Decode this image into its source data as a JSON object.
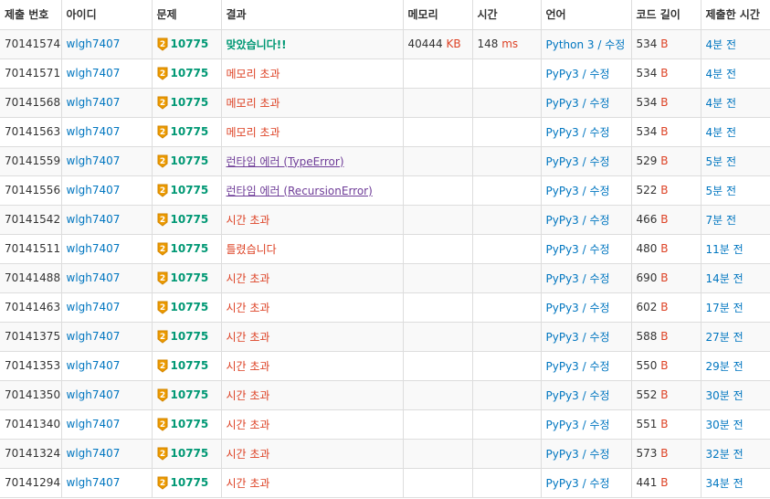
{
  "headers": [
    "제출 번호",
    "아이디",
    "문제",
    "결과",
    "메모리",
    "시간",
    "언어",
    "코드 길이",
    "제출한 시간"
  ],
  "edit_label": "수정",
  "tier_badge": "2",
  "mem_unit": "KB",
  "time_unit": "ms",
  "len_unit": "B",
  "rows": [
    {
      "id": "70141574",
      "user": "wlgh7407",
      "problem": "10775",
      "result": "맞았습니다!!",
      "rclass": "green-bold",
      "memory": "40444",
      "time": "148",
      "lang": "Python 3",
      "len": "534",
      "ago": "4분 전"
    },
    {
      "id": "70141571",
      "user": "wlgh7407",
      "problem": "10775",
      "result": "메모리 초과",
      "rclass": "red",
      "memory": "",
      "time": "",
      "lang": "PyPy3",
      "len": "534",
      "ago": "4분 전"
    },
    {
      "id": "70141568",
      "user": "wlgh7407",
      "problem": "10775",
      "result": "메모리 초과",
      "rclass": "red",
      "memory": "",
      "time": "",
      "lang": "PyPy3",
      "len": "534",
      "ago": "4분 전"
    },
    {
      "id": "70141563",
      "user": "wlgh7407",
      "problem": "10775",
      "result": "메모리 초과",
      "rclass": "red",
      "memory": "",
      "time": "",
      "lang": "PyPy3",
      "len": "534",
      "ago": "4분 전"
    },
    {
      "id": "70141559",
      "user": "wlgh7407",
      "problem": "10775",
      "result": "런타임 에러 (TypeError)",
      "rclass": "rt",
      "memory": "",
      "time": "",
      "lang": "PyPy3",
      "len": "529",
      "ago": "5분 전"
    },
    {
      "id": "70141556",
      "user": "wlgh7407",
      "problem": "10775",
      "result": "런타임 에러 (RecursionError)",
      "rclass": "rt",
      "memory": "",
      "time": "",
      "lang": "PyPy3",
      "len": "522",
      "ago": "5분 전"
    },
    {
      "id": "70141542",
      "user": "wlgh7407",
      "problem": "10775",
      "result": "시간 초과",
      "rclass": "red",
      "memory": "",
      "time": "",
      "lang": "PyPy3",
      "len": "466",
      "ago": "7분 전"
    },
    {
      "id": "70141511",
      "user": "wlgh7407",
      "problem": "10775",
      "result": "틀렸습니다",
      "rclass": "red",
      "memory": "",
      "time": "",
      "lang": "PyPy3",
      "len": "480",
      "ago": "11분 전"
    },
    {
      "id": "70141488",
      "user": "wlgh7407",
      "problem": "10775",
      "result": "시간 초과",
      "rclass": "red",
      "memory": "",
      "time": "",
      "lang": "PyPy3",
      "len": "690",
      "ago": "14분 전"
    },
    {
      "id": "70141463",
      "user": "wlgh7407",
      "problem": "10775",
      "result": "시간 초과",
      "rclass": "red",
      "memory": "",
      "time": "",
      "lang": "PyPy3",
      "len": "602",
      "ago": "17분 전"
    },
    {
      "id": "70141375",
      "user": "wlgh7407",
      "problem": "10775",
      "result": "시간 초과",
      "rclass": "red",
      "memory": "",
      "time": "",
      "lang": "PyPy3",
      "len": "588",
      "ago": "27분 전"
    },
    {
      "id": "70141353",
      "user": "wlgh7407",
      "problem": "10775",
      "result": "시간 초과",
      "rclass": "red",
      "memory": "",
      "time": "",
      "lang": "PyPy3",
      "len": "550",
      "ago": "29분 전"
    },
    {
      "id": "70141350",
      "user": "wlgh7407",
      "problem": "10775",
      "result": "시간 초과",
      "rclass": "red",
      "memory": "",
      "time": "",
      "lang": "PyPy3",
      "len": "552",
      "ago": "30분 전"
    },
    {
      "id": "70141340",
      "user": "wlgh7407",
      "problem": "10775",
      "result": "시간 초과",
      "rclass": "red",
      "memory": "",
      "time": "",
      "lang": "PyPy3",
      "len": "551",
      "ago": "30분 전"
    },
    {
      "id": "70141324",
      "user": "wlgh7407",
      "problem": "10775",
      "result": "시간 초과",
      "rclass": "red",
      "memory": "",
      "time": "",
      "lang": "PyPy3",
      "len": "573",
      "ago": "32분 전"
    },
    {
      "id": "70141294",
      "user": "wlgh7407",
      "problem": "10775",
      "result": "시간 초과",
      "rclass": "red",
      "memory": "",
      "time": "",
      "lang": "PyPy3",
      "len": "441",
      "ago": "34분 전"
    }
  ]
}
